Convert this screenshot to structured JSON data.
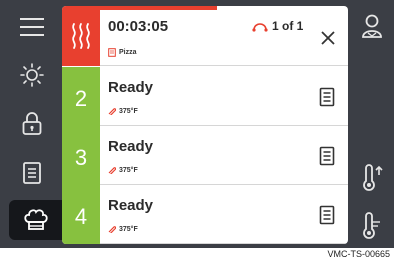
{
  "colors": {
    "rail_bg": "#3b3e45",
    "active_bg": "#15171b",
    "heat_red": "#e8402f",
    "ready_green": "#87c13f",
    "text_dark": "#2b2b2b"
  },
  "left_rail": [
    {
      "icon": "menu-icon"
    },
    {
      "icon": "brightness-icon"
    },
    {
      "icon": "lock-icon"
    },
    {
      "icon": "recipe-book-icon"
    },
    {
      "icon": "chef-hat-icon",
      "active": true
    }
  ],
  "right_rail": [
    {
      "icon": "user-icon"
    },
    {
      "icon": "temperature-up-icon"
    },
    {
      "icon": "temperature-probe-icon"
    }
  ],
  "active_cook": {
    "timer": "00:03:05",
    "recipe": "Pizza",
    "count_text": "1 of 1",
    "progress": 0.47,
    "heat_icon": "heat-icon"
  },
  "rows": [
    {
      "number": "2",
      "status": "Ready",
      "temperature": "375°F"
    },
    {
      "number": "3",
      "status": "Ready",
      "temperature": "375°F"
    },
    {
      "number": "4",
      "status": "Ready",
      "temperature": "375°F"
    }
  ],
  "footer_code": "VMC-TS-00665"
}
